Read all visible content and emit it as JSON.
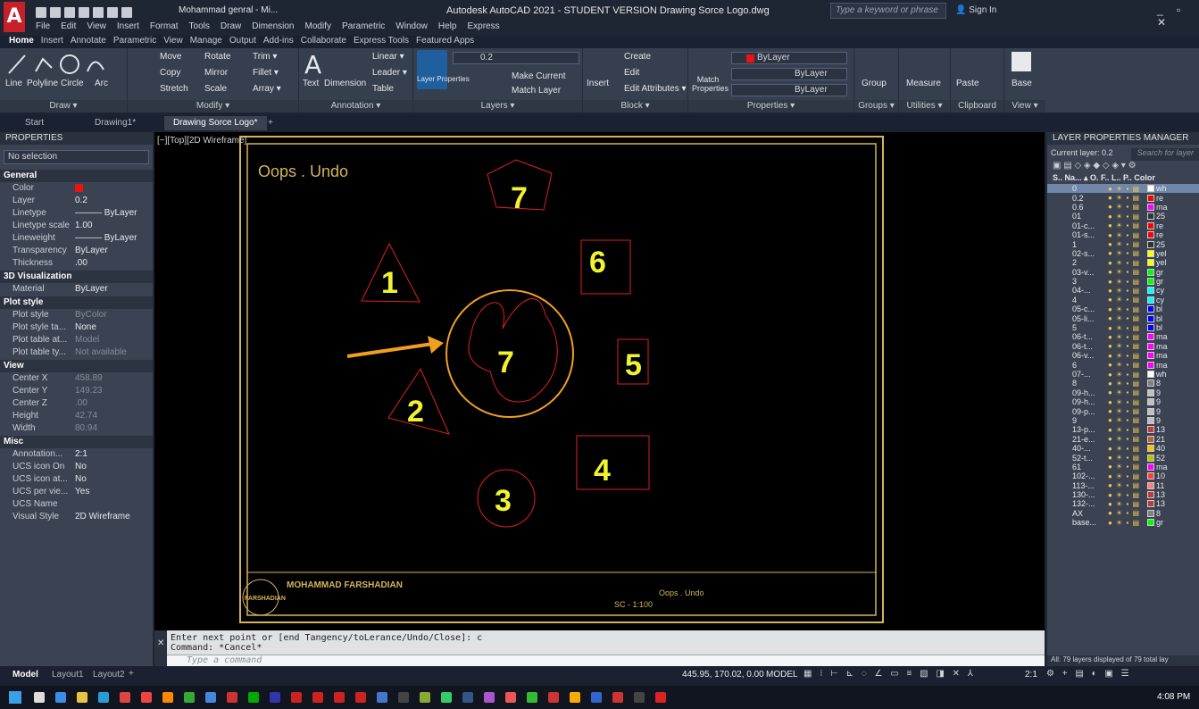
{
  "app": {
    "title": "Autodesk AutoCAD 2021 - STUDENT VERSION   Drawing Sorce Logo.dwg",
    "workspace": "Mohammad genral - Mi...",
    "search_placeholder": "Type a keyword or phrase",
    "sign_in": "Sign In"
  },
  "menu": [
    "File",
    "Edit",
    "View",
    "Insert",
    "Format",
    "Tools",
    "Draw",
    "Dimension",
    "Modify",
    "Parametric",
    "Window",
    "Help",
    "Express"
  ],
  "ribbon_tabs": [
    "Home",
    "Insert",
    "Annotate",
    "Parametric",
    "View",
    "Manage",
    "Output",
    "Add-ins",
    "Collaborate",
    "Express Tools",
    "Featured Apps"
  ],
  "ribbon": {
    "draw": {
      "label": "Draw ▾",
      "tools": [
        "Line",
        "Polyline",
        "Circle",
        "Arc"
      ]
    },
    "modify": {
      "label": "Modify ▾",
      "tools": [
        "Move",
        "Rotate",
        "Trim ▾",
        "Copy",
        "Mirror",
        "Fillet ▾",
        "Stretch",
        "Scale",
        "Array ▾"
      ]
    },
    "annotation": {
      "label": "Annotation ▾",
      "tools": [
        "Text",
        "Dimension",
        "Linear ▾",
        "Leader ▾",
        "Table"
      ]
    },
    "layers": {
      "label": "Layers ▾",
      "tools": [
        "Layer Properties",
        "Make Current",
        "Match Layer"
      ],
      "current": "0.2"
    },
    "block": {
      "label": "Block ▾",
      "tools": [
        "Insert",
        "Create",
        "Edit",
        "Edit Attributes ▾"
      ]
    },
    "properties": {
      "label": "Properties ▾",
      "tools": [
        "Match Properties"
      ],
      "color": "ByLayer",
      "linetype": "ByLayer",
      "lineweight": "ByLayer"
    },
    "groups": {
      "label": "Groups ▾",
      "tools": [
        "Group"
      ]
    },
    "utilities": {
      "label": "Utilities ▾",
      "tools": [
        "Measure"
      ]
    },
    "clipboard": {
      "label": "Clipboard",
      "tools": [
        "Paste",
        "Base"
      ]
    },
    "view": {
      "label": "View ▾"
    }
  },
  "doc_tabs": [
    "Start",
    "Drawing1*",
    "Drawing Sorce Logo*"
  ],
  "properties": {
    "header": "PROPERTIES",
    "selection": "No selection",
    "sections": [
      {
        "name": "General",
        "rows": [
          [
            "Color",
            "ByLayer"
          ],
          [
            "Layer",
            "0.2"
          ],
          [
            "Linetype",
            "——— ByLayer"
          ],
          [
            "Linetype scale",
            "1.00"
          ],
          [
            "Lineweight",
            "——— ByLayer"
          ],
          [
            "Transparency",
            "ByLayer"
          ],
          [
            "Thickness",
            ".00"
          ]
        ]
      },
      {
        "name": "3D Visualization",
        "rows": [
          [
            "Material",
            "ByLayer"
          ]
        ]
      },
      {
        "name": "Plot style",
        "rows": [
          [
            "Plot style",
            "ByColor"
          ],
          [
            "Plot style ta...",
            "None"
          ],
          [
            "Plot table at...",
            "Model"
          ],
          [
            "Plot table ty...",
            "Not available"
          ]
        ]
      },
      {
        "name": "View",
        "rows": [
          [
            "Center X",
            "458.89"
          ],
          [
            "Center Y",
            "149.23"
          ],
          [
            "Center Z",
            ".00"
          ],
          [
            "Height",
            "42.74"
          ],
          [
            "Width",
            "80.94"
          ]
        ]
      },
      {
        "name": "Misc",
        "rows": [
          [
            "Annotation...",
            "2:1"
          ],
          [
            "UCS icon On",
            "No"
          ],
          [
            "UCS icon at...",
            "No"
          ],
          [
            "UCS per vie...",
            "Yes"
          ],
          [
            "UCS Name",
            ""
          ],
          [
            "Visual Style",
            "2D Wireframe"
          ]
        ]
      }
    ]
  },
  "viewport": {
    "label": "[−][Top][2D Wireframe]",
    "note": "Oops . Undo",
    "shapes": [
      "7",
      "1",
      "6",
      "7",
      "5",
      "2",
      "4",
      "3"
    ],
    "title_block": {
      "name": "MOHAMMAD FARSHADIAN",
      "logo_text": "FARSHADIAN",
      "project": "Oops . Undo",
      "scale": "SC - 1:100"
    }
  },
  "command": {
    "line1": "Enter next point or [end Tangency/toLerance/Undo/Close]: c",
    "line2": "Command: *Cancel*",
    "placeholder": "Type a command"
  },
  "layer_manager": {
    "header": "LAYER PROPERTIES MANAGER",
    "current": "Current layer: 0.2",
    "search": "Search for layer",
    "columns": "S.. Na... ▴ O. F.. L.. P.. Color",
    "layers": [
      {
        "n": "0",
        "c": "wh",
        "h": "#ffffff"
      },
      {
        "n": "0.2",
        "c": "re",
        "h": "#ff0000"
      },
      {
        "n": "0.6",
        "c": "ma",
        "h": "#ff00ff"
      },
      {
        "n": "01",
        "c": "25",
        "h": "#333333"
      },
      {
        "n": "01-c...",
        "c": "re",
        "h": "#ff0000"
      },
      {
        "n": "01-s...",
        "c": "re",
        "h": "#ff0000"
      },
      {
        "n": "1",
        "c": "25",
        "h": "#333333"
      },
      {
        "n": "02-s...",
        "c": "yel",
        "h": "#ffff00"
      },
      {
        "n": "2",
        "c": "yel",
        "h": "#ffff00"
      },
      {
        "n": "03-v...",
        "c": "gr",
        "h": "#00ff00"
      },
      {
        "n": "3",
        "c": "gr",
        "h": "#00ff00"
      },
      {
        "n": "04-...",
        "c": "cy",
        "h": "#00ffff"
      },
      {
        "n": "4",
        "c": "cy",
        "h": "#00ffff"
      },
      {
        "n": "05-c...",
        "c": "bl",
        "h": "#0000ff"
      },
      {
        "n": "05-li...",
        "c": "bl",
        "h": "#0000ff"
      },
      {
        "n": "5",
        "c": "bl",
        "h": "#0000ff"
      },
      {
        "n": "06-t...",
        "c": "ma",
        "h": "#ff00ff"
      },
      {
        "n": "06-t...",
        "c": "ma",
        "h": "#ff00ff"
      },
      {
        "n": "06-v...",
        "c": "ma",
        "h": "#ff00ff"
      },
      {
        "n": "6",
        "c": "ma",
        "h": "#ff00ff"
      },
      {
        "n": "07-...",
        "c": "wh",
        "h": "#ffffff"
      },
      {
        "n": "8",
        "c": "8",
        "h": "#808080"
      },
      {
        "n": "09-h...",
        "c": "9",
        "h": "#c0c0c0"
      },
      {
        "n": "09-h...",
        "c": "9",
        "h": "#c0c0c0"
      },
      {
        "n": "09-p...",
        "c": "9",
        "h": "#c0c0c0"
      },
      {
        "n": "9",
        "c": "9",
        "h": "#c0c0c0"
      },
      {
        "n": "13-p...",
        "c": "13",
        "h": "#bd3b3b"
      },
      {
        "n": "21-e...",
        "c": "21",
        "h": "#bd5e3b"
      },
      {
        "n": "40-...",
        "c": "40",
        "h": "#ffbf00"
      },
      {
        "n": "52-t...",
        "c": "52",
        "h": "#bfbf00"
      },
      {
        "n": "61",
        "c": "ma",
        "h": "#ff00ff"
      },
      {
        "n": "102-...",
        "c": "10",
        "h": "#ff3f3f"
      },
      {
        "n": "113-...",
        "c": "11",
        "h": "#ff7f7f"
      },
      {
        "n": "130-...",
        "c": "13",
        "h": "#bd3b3b"
      },
      {
        "n": "132-...",
        "c": "13",
        "h": "#bd3b3b"
      },
      {
        "n": "AX",
        "c": "8",
        "h": "#808080"
      },
      {
        "n": "base...",
        "c": "gr",
        "h": "#00ff00"
      }
    ],
    "footer": "All: 79 layers displayed of 79 total lay"
  },
  "status": {
    "tabs": [
      "Model",
      "Layout1",
      "Layout2"
    ],
    "coords": "445.95, 170.02, 0.00",
    "model": "MODEL",
    "scale": "2:1"
  },
  "taskbar": {
    "time": "4:08 PM"
  }
}
